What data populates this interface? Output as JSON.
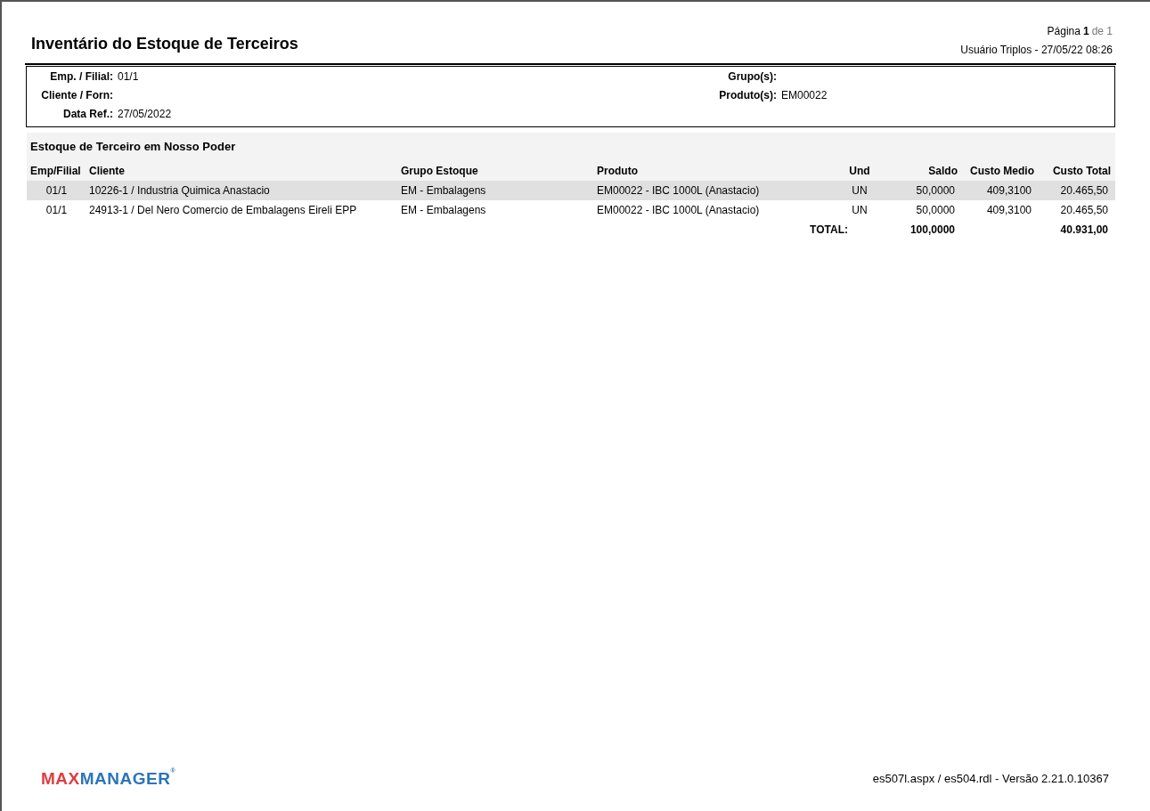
{
  "header": {
    "title": "Inventário do Estoque de Terceiros",
    "page_label": "Página",
    "page_number": "1",
    "page_of": "de 1",
    "user_line": "Usuário Triplos - 27/05/22 08:26"
  },
  "filters": {
    "left": [
      {
        "label": "Emp. / Filial:",
        "value": "01/1"
      },
      {
        "label": "Cliente / Forn:"
      },
      {
        "label": "Data Ref.:",
        "value": "27/05/2022"
      }
    ],
    "right": [
      {
        "label": "Grupo(s):"
      },
      {
        "label": "Produto(s):",
        "value": "EM00022"
      }
    ]
  },
  "section": {
    "title": "Estoque de Terceiro em Nosso Poder",
    "columns": [
      "Emp/Filial",
      "Cliente",
      "Grupo Estoque",
      "Produto",
      "Und",
      "Saldo",
      "Custo Medio",
      "Custo Total"
    ],
    "rows": [
      {
        "shaded": true,
        "cells": [
          "01/1",
          "10226-1 / Industria Quimica Anastacio",
          "EM - Embalagens",
          "EM00022 - IBC 1000L (Anastacio)",
          "UN",
          "50,0000",
          "409,3100",
          "20.465,50"
        ]
      },
      {
        "shaded": false,
        "cells": [
          "01/1",
          "24913-1 / Del Nero Comercio de Embalagens Eireli EPP",
          "EM - Embalagens",
          "EM00022 - IBC 1000L (Anastacio)",
          "UN",
          "50,0000",
          "409,3100",
          "20.465,50"
        ]
      }
    ],
    "total": {
      "label": "TOTAL:",
      "saldo": "100,0000",
      "custo_total": "40.931,00"
    }
  },
  "footer": {
    "logo_first": "MAX",
    "logo_second": "MANAGER",
    "logo_mark": "®",
    "version": "es507l.aspx / es504.rdl - Versão 2.21.0.10367"
  }
}
